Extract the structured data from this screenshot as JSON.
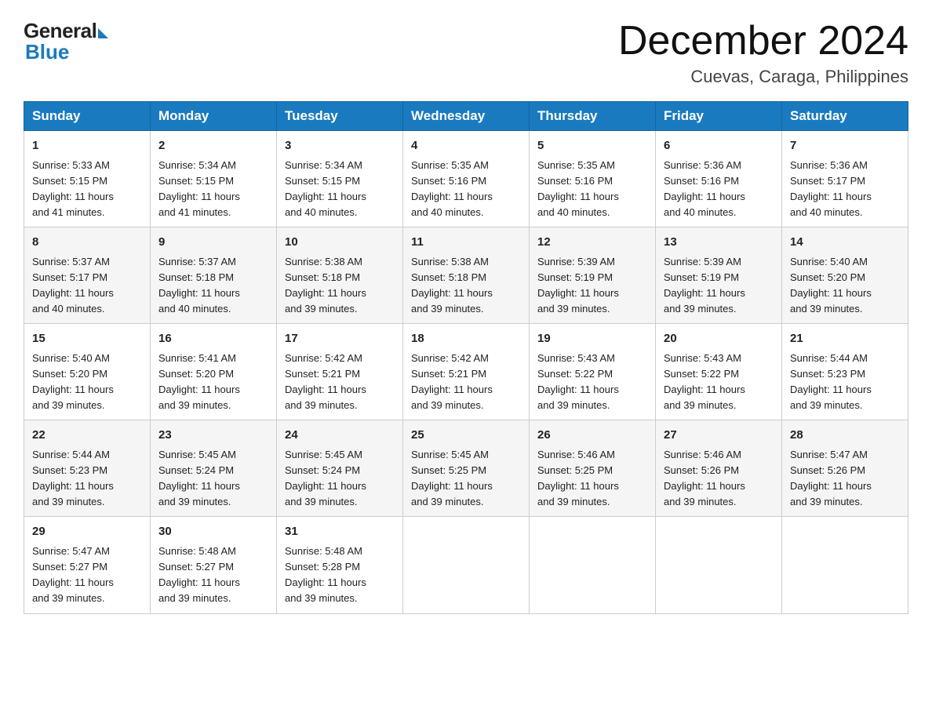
{
  "header": {
    "logo_general": "General",
    "logo_blue": "Blue",
    "month_title": "December 2024",
    "location": "Cuevas, Caraga, Philippines"
  },
  "weekdays": [
    "Sunday",
    "Monday",
    "Tuesday",
    "Wednesday",
    "Thursday",
    "Friday",
    "Saturday"
  ],
  "weeks": [
    [
      {
        "day": "1",
        "sunrise": "5:33 AM",
        "sunset": "5:15 PM",
        "daylight": "11 hours and 41 minutes."
      },
      {
        "day": "2",
        "sunrise": "5:34 AM",
        "sunset": "5:15 PM",
        "daylight": "11 hours and 41 minutes."
      },
      {
        "day": "3",
        "sunrise": "5:34 AM",
        "sunset": "5:15 PM",
        "daylight": "11 hours and 40 minutes."
      },
      {
        "day": "4",
        "sunrise": "5:35 AM",
        "sunset": "5:16 PM",
        "daylight": "11 hours and 40 minutes."
      },
      {
        "day": "5",
        "sunrise": "5:35 AM",
        "sunset": "5:16 PM",
        "daylight": "11 hours and 40 minutes."
      },
      {
        "day": "6",
        "sunrise": "5:36 AM",
        "sunset": "5:16 PM",
        "daylight": "11 hours and 40 minutes."
      },
      {
        "day": "7",
        "sunrise": "5:36 AM",
        "sunset": "5:17 PM",
        "daylight": "11 hours and 40 minutes."
      }
    ],
    [
      {
        "day": "8",
        "sunrise": "5:37 AM",
        "sunset": "5:17 PM",
        "daylight": "11 hours and 40 minutes."
      },
      {
        "day": "9",
        "sunrise": "5:37 AM",
        "sunset": "5:18 PM",
        "daylight": "11 hours and 40 minutes."
      },
      {
        "day": "10",
        "sunrise": "5:38 AM",
        "sunset": "5:18 PM",
        "daylight": "11 hours and 39 minutes."
      },
      {
        "day": "11",
        "sunrise": "5:38 AM",
        "sunset": "5:18 PM",
        "daylight": "11 hours and 39 minutes."
      },
      {
        "day": "12",
        "sunrise": "5:39 AM",
        "sunset": "5:19 PM",
        "daylight": "11 hours and 39 minutes."
      },
      {
        "day": "13",
        "sunrise": "5:39 AM",
        "sunset": "5:19 PM",
        "daylight": "11 hours and 39 minutes."
      },
      {
        "day": "14",
        "sunrise": "5:40 AM",
        "sunset": "5:20 PM",
        "daylight": "11 hours and 39 minutes."
      }
    ],
    [
      {
        "day": "15",
        "sunrise": "5:40 AM",
        "sunset": "5:20 PM",
        "daylight": "11 hours and 39 minutes."
      },
      {
        "day": "16",
        "sunrise": "5:41 AM",
        "sunset": "5:20 PM",
        "daylight": "11 hours and 39 minutes."
      },
      {
        "day": "17",
        "sunrise": "5:42 AM",
        "sunset": "5:21 PM",
        "daylight": "11 hours and 39 minutes."
      },
      {
        "day": "18",
        "sunrise": "5:42 AM",
        "sunset": "5:21 PM",
        "daylight": "11 hours and 39 minutes."
      },
      {
        "day": "19",
        "sunrise": "5:43 AM",
        "sunset": "5:22 PM",
        "daylight": "11 hours and 39 minutes."
      },
      {
        "day": "20",
        "sunrise": "5:43 AM",
        "sunset": "5:22 PM",
        "daylight": "11 hours and 39 minutes."
      },
      {
        "day": "21",
        "sunrise": "5:44 AM",
        "sunset": "5:23 PM",
        "daylight": "11 hours and 39 minutes."
      }
    ],
    [
      {
        "day": "22",
        "sunrise": "5:44 AM",
        "sunset": "5:23 PM",
        "daylight": "11 hours and 39 minutes."
      },
      {
        "day": "23",
        "sunrise": "5:45 AM",
        "sunset": "5:24 PM",
        "daylight": "11 hours and 39 minutes."
      },
      {
        "day": "24",
        "sunrise": "5:45 AM",
        "sunset": "5:24 PM",
        "daylight": "11 hours and 39 minutes."
      },
      {
        "day": "25",
        "sunrise": "5:45 AM",
        "sunset": "5:25 PM",
        "daylight": "11 hours and 39 minutes."
      },
      {
        "day": "26",
        "sunrise": "5:46 AM",
        "sunset": "5:25 PM",
        "daylight": "11 hours and 39 minutes."
      },
      {
        "day": "27",
        "sunrise": "5:46 AM",
        "sunset": "5:26 PM",
        "daylight": "11 hours and 39 minutes."
      },
      {
        "day": "28",
        "sunrise": "5:47 AM",
        "sunset": "5:26 PM",
        "daylight": "11 hours and 39 minutes."
      }
    ],
    [
      {
        "day": "29",
        "sunrise": "5:47 AM",
        "sunset": "5:27 PM",
        "daylight": "11 hours and 39 minutes."
      },
      {
        "day": "30",
        "sunrise": "5:48 AM",
        "sunset": "5:27 PM",
        "daylight": "11 hours and 39 minutes."
      },
      {
        "day": "31",
        "sunrise": "5:48 AM",
        "sunset": "5:28 PM",
        "daylight": "11 hours and 39 minutes."
      },
      null,
      null,
      null,
      null
    ]
  ],
  "labels": {
    "sunrise": "Sunrise:",
    "sunset": "Sunset:",
    "daylight": "Daylight:"
  }
}
